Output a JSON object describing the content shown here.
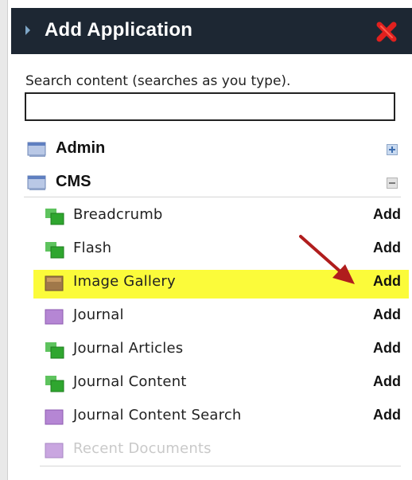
{
  "window": {
    "title": "Add Application"
  },
  "search": {
    "label": "Search content (searches as you type).",
    "value": "",
    "placeholder": ""
  },
  "categories": [
    {
      "label": "Admin",
      "state": "collapsed"
    },
    {
      "label": "CMS",
      "state": "expanded"
    }
  ],
  "cms_items": [
    {
      "label": "Breadcrumb",
      "action": "Add",
      "icon": "green-portlet-icon"
    },
    {
      "label": "Flash",
      "action": "Add",
      "icon": "green-portlet-icon"
    },
    {
      "label": "Image Gallery",
      "action": "Add",
      "icon": "brown-portlet-icon",
      "highlighted": true
    },
    {
      "label": "Journal",
      "action": "Add",
      "icon": "purple-portlet-icon"
    },
    {
      "label": "Journal Articles",
      "action": "Add",
      "icon": "green-portlet-icon"
    },
    {
      "label": "Journal Content",
      "action": "Add",
      "icon": "green-portlet-icon"
    },
    {
      "label": "Journal Content Search",
      "action": "Add",
      "icon": "purple-portlet-icon"
    },
    {
      "label": "Recent Documents",
      "action": "",
      "icon": "purple-portlet-icon",
      "disabled": true
    }
  ],
  "colors": {
    "header_bg": "#1d2733",
    "highlight": "#fbfb3a",
    "arrow": "#b01d1d",
    "close": "#e0201e"
  }
}
